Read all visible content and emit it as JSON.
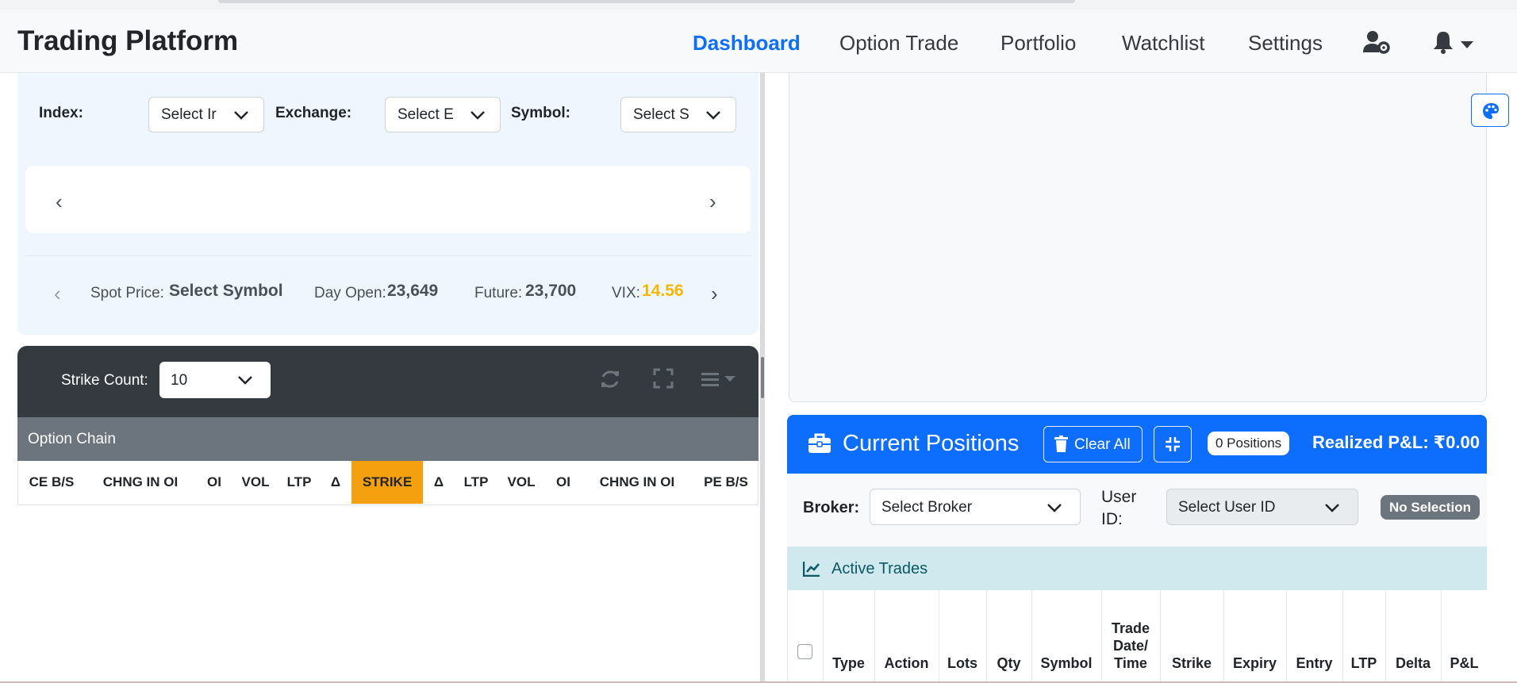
{
  "navbar": {
    "brand": "Trading Platform",
    "links": [
      "Dashboard",
      "Option Trade",
      "Portfolio",
      "Watchlist",
      "Settings"
    ],
    "active": "Dashboard",
    "icons": [
      "user-gear-icon",
      "bell-icon",
      "caret-down-icon"
    ]
  },
  "selectors": {
    "index_label": "Index:",
    "index_value": "Select Ir",
    "exchange_label": "Exchange:",
    "exchange_value": "Select E",
    "symbol_label": "Symbol:",
    "symbol_value": "Select S"
  },
  "carousel": {
    "prev": "‹",
    "next": "›"
  },
  "market": {
    "prev": "‹",
    "next": "›",
    "spot_label": "Spot Price:",
    "spot_value": "Select Symbol",
    "day_open_label": "Day Open:",
    "day_open_value": "23,649",
    "future_label": "Future:",
    "future_value": "23,700",
    "vix_label": "VIX:",
    "vix_value": "14.56"
  },
  "toolbar": {
    "strike_count_label": "Strike Count:",
    "strike_count_value": "10",
    "icons": [
      "refresh-icon",
      "fullscreen-icon",
      "menu-dropdown-icon"
    ]
  },
  "option_chain": {
    "title": "Option Chain",
    "columns": [
      "CE B/S",
      "CHNG IN OI",
      "OI",
      "VOL",
      "LTP",
      "Δ",
      "STRIKE",
      "Δ",
      "LTP",
      "VOL",
      "OI",
      "CHNG IN OI",
      "PE B/S"
    ]
  },
  "positions": {
    "title": "Current Positions",
    "clear_all": "Clear All",
    "count": "0 Positions",
    "realized": "Realized P&L: ₹0.00",
    "broker_label": "Broker:",
    "broker_value": "Select Broker",
    "user_label_1": "User",
    "user_label_2": "ID:",
    "user_value": "Select User ID",
    "no_selection": "No Selection",
    "active_trades": "Active Trades",
    "columns": [
      "Type",
      "Action",
      "Lots",
      "Qty",
      "Symbol",
      "Trade Date/ Time",
      "Strike",
      "Expiry",
      "Entry",
      "LTP",
      "Delta",
      "P&L"
    ]
  },
  "colors": {
    "primary": "#0d6efd",
    "strike_highlight": "#f5a00f",
    "vix": "#f5b800",
    "toolbar_dark": "#343a40",
    "chain_header": "#6c757d",
    "active_trades_bg": "#cfe9ef"
  }
}
